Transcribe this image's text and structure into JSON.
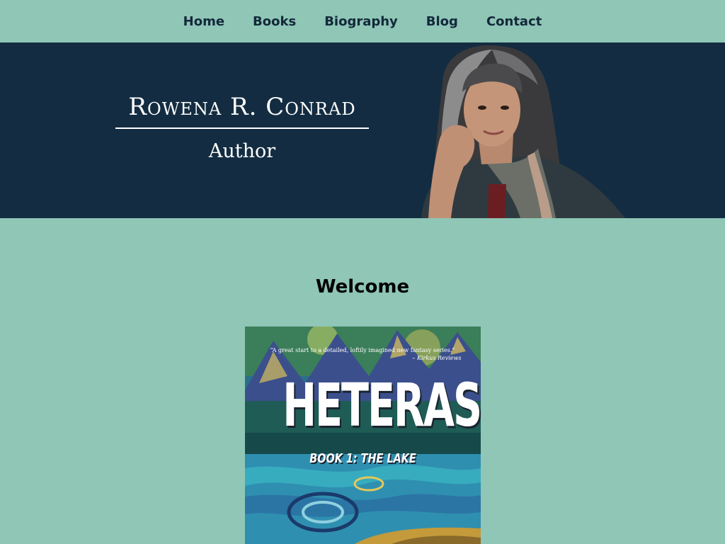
{
  "nav": {
    "items": [
      {
        "label": "Home"
      },
      {
        "label": "Books"
      },
      {
        "label": "Biography"
      },
      {
        "label": "Blog"
      },
      {
        "label": "Contact"
      }
    ]
  },
  "hero": {
    "name": "Rowena R. Conrad",
    "role": "Author"
  },
  "main": {
    "heading": "Welcome",
    "book": {
      "title": "HETERAS",
      "subtitle": "BOOK 1: THE LAKE",
      "quote": "“A great start to a detailed, loftily imagined new fantasy series.”",
      "quote_source": "– Kirkus Reviews"
    }
  },
  "colors": {
    "page_background": "#8fc6b6",
    "hero_background": "#132c41",
    "nav_text": "#13283a"
  }
}
